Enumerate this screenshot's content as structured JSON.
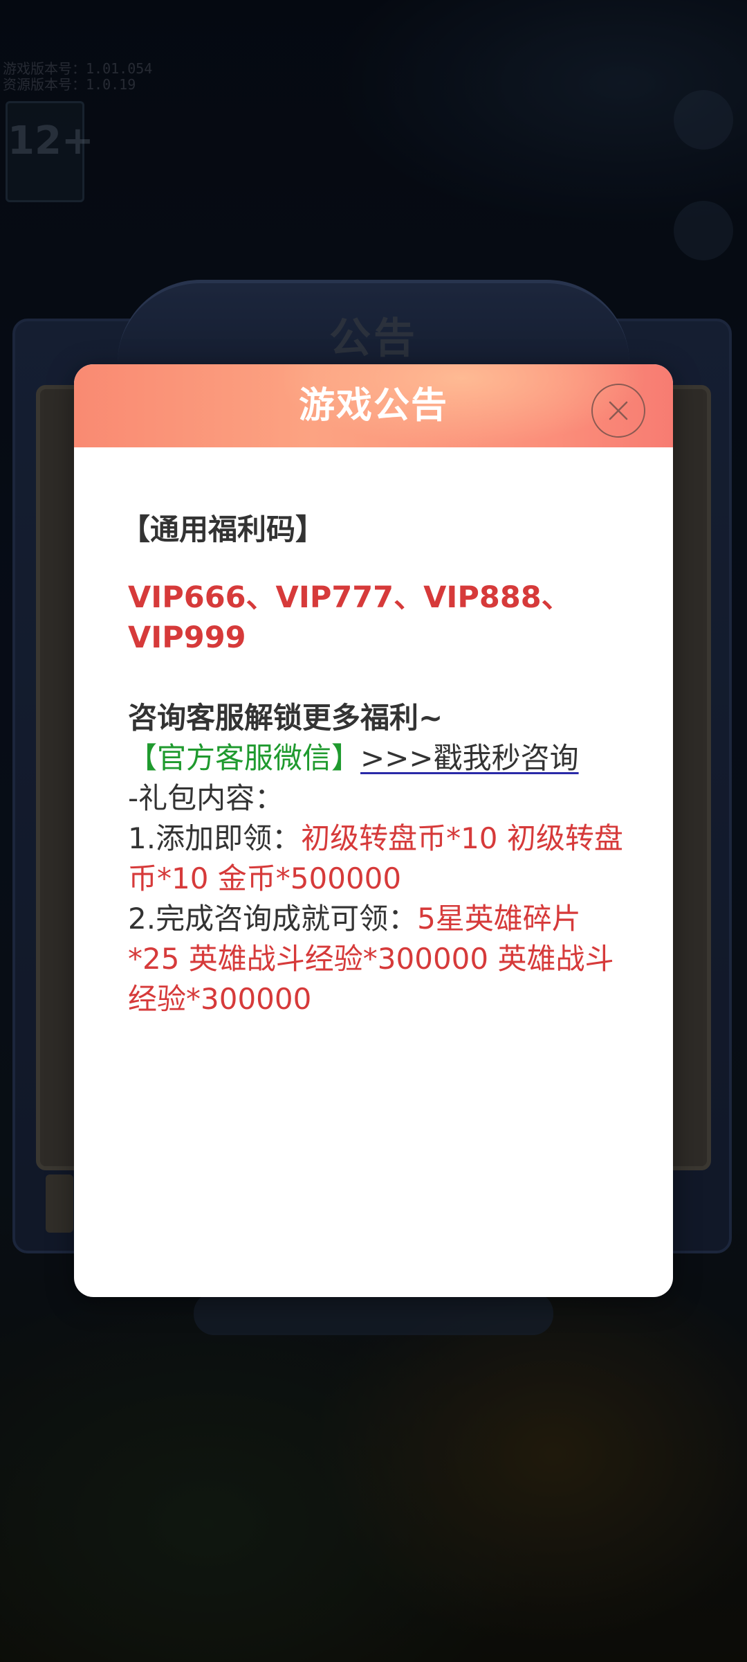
{
  "background": {
    "version_lines": [
      "游戏版本号：1.01.054",
      "资源版本号：1.0.19"
    ],
    "age_rating": "12+",
    "panel_title": "公告",
    "right_buttons": [
      "",
      ""
    ],
    "hint": "",
    "health_notice": {
      "title": "",
      "line1": "",
      "line2": ""
    }
  },
  "modal": {
    "title": "游戏公告",
    "close_icon": "close-icon",
    "section_title": "【通用福利码】",
    "codes_line1": "VIP666、VIP777、VIP888、",
    "codes_line2": "VIP999",
    "consult_text": "咨询客服解锁更多福利~",
    "wechat_label": "【官方客服微信】",
    "wechat_link": ">>>戳我秒咨询",
    "gift_heading": "-礼包内容：",
    "item1_prefix": "1.添加即领：",
    "item1_value": "初级转盘币*10 初级转盘币*10 金币*500000",
    "item2_prefix": "2.完成咨询成就可领：",
    "item2_value": "5星英雄碎片*25 英雄战斗经验*300000 英雄战斗经验*300000"
  },
  "colors": {
    "header_start": "#f98a72",
    "header_end": "#f77c72",
    "reward_red": "#d63a3a",
    "wechat_green": "#1f9a2e",
    "link_underline": "#2a2aa8"
  }
}
